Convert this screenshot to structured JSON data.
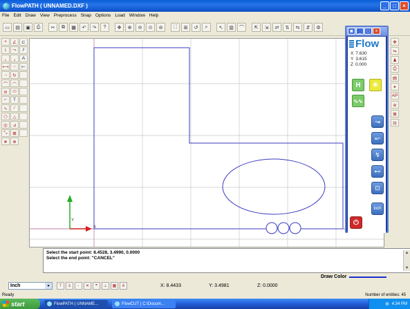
{
  "window": {
    "title": "FlowPATH ( UNNAMED.DXF )"
  },
  "menu": [
    "File",
    "Edit",
    "Draw",
    "View",
    "Preprocess",
    "Snap",
    "Options",
    "Load",
    "Window",
    "Help"
  ],
  "flow_panel": {
    "logo_text": "Flow",
    "x_label": "X",
    "x_value": "7.630",
    "y_label": "Y",
    "y_value": "3.615",
    "z_label": "Z",
    "z_value": "0.000",
    "h_button": "H",
    "inch_button": "inch"
  },
  "command_log": {
    "line1": "Select the start point: 8.4528, 3.4990, 0.0000",
    "line2": "Select the end point: \"CANCEL\""
  },
  "draw_color": {
    "label": "Draw Color",
    "color": "#1a2fd0"
  },
  "status": {
    "units": "Inch",
    "x_readout": "X: 8.4433",
    "y_readout": "Y: 3.4981",
    "z_readout": "Z: 0.0000",
    "ready": "Ready",
    "entities": "Number of entities: 45"
  },
  "taskbar": {
    "start": "start",
    "task1": "FlowPATH ( UNNAME...",
    "task2": "FlowCUT ( C:\\Docum...",
    "clock": "4:34 PM"
  },
  "colors": {
    "geometry": "#3a3ac0",
    "axis_x": "#d02020",
    "axis_y": "#20b020",
    "grid": "#c8c8c8"
  }
}
